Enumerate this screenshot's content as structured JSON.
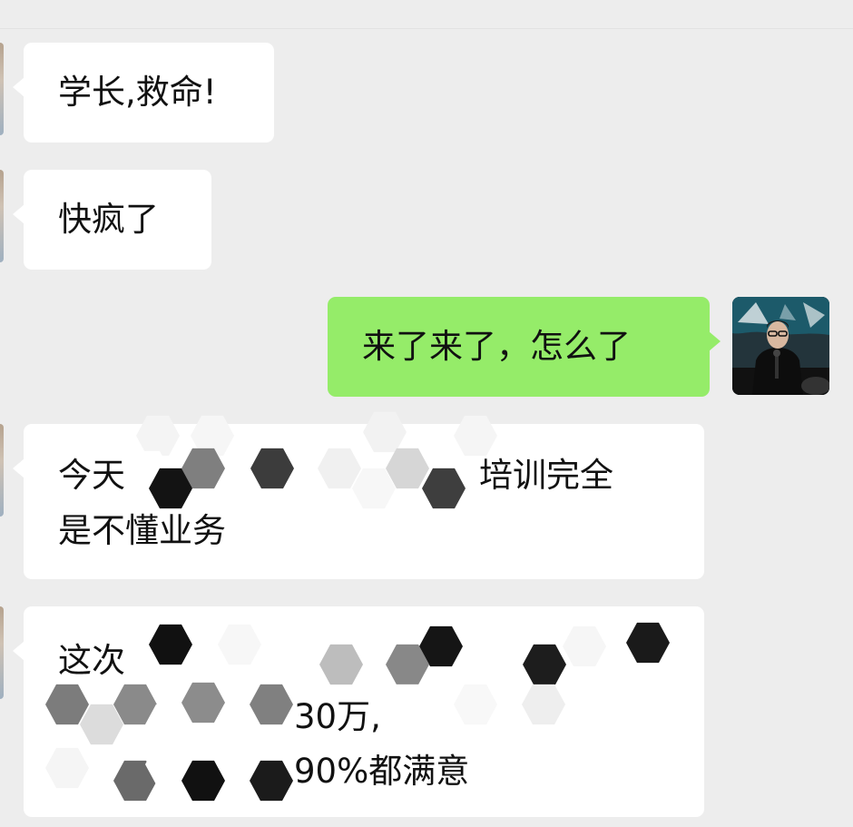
{
  "chat": {
    "messages": [
      {
        "side": "incoming",
        "text": "学长,救命!"
      },
      {
        "side": "incoming",
        "text": "快疯了"
      },
      {
        "side": "outgoing",
        "text": "来了来了，怎么了"
      },
      {
        "side": "incoming",
        "lines": [
          "今天",
          "培训完全",
          "是不懂业务"
        ]
      },
      {
        "side": "incoming",
        "lines": [
          "这次",
          "30万,",
          "90%都满意"
        ]
      }
    ]
  },
  "colors": {
    "background": "#ededed",
    "incoming_bubble": "#ffffff",
    "outgoing_bubble": "#95ec69",
    "text": "#111111"
  },
  "icons": {
    "own_avatar": "person-speaking-avatar",
    "mosaic": "censor-mosaic-hexagon"
  }
}
